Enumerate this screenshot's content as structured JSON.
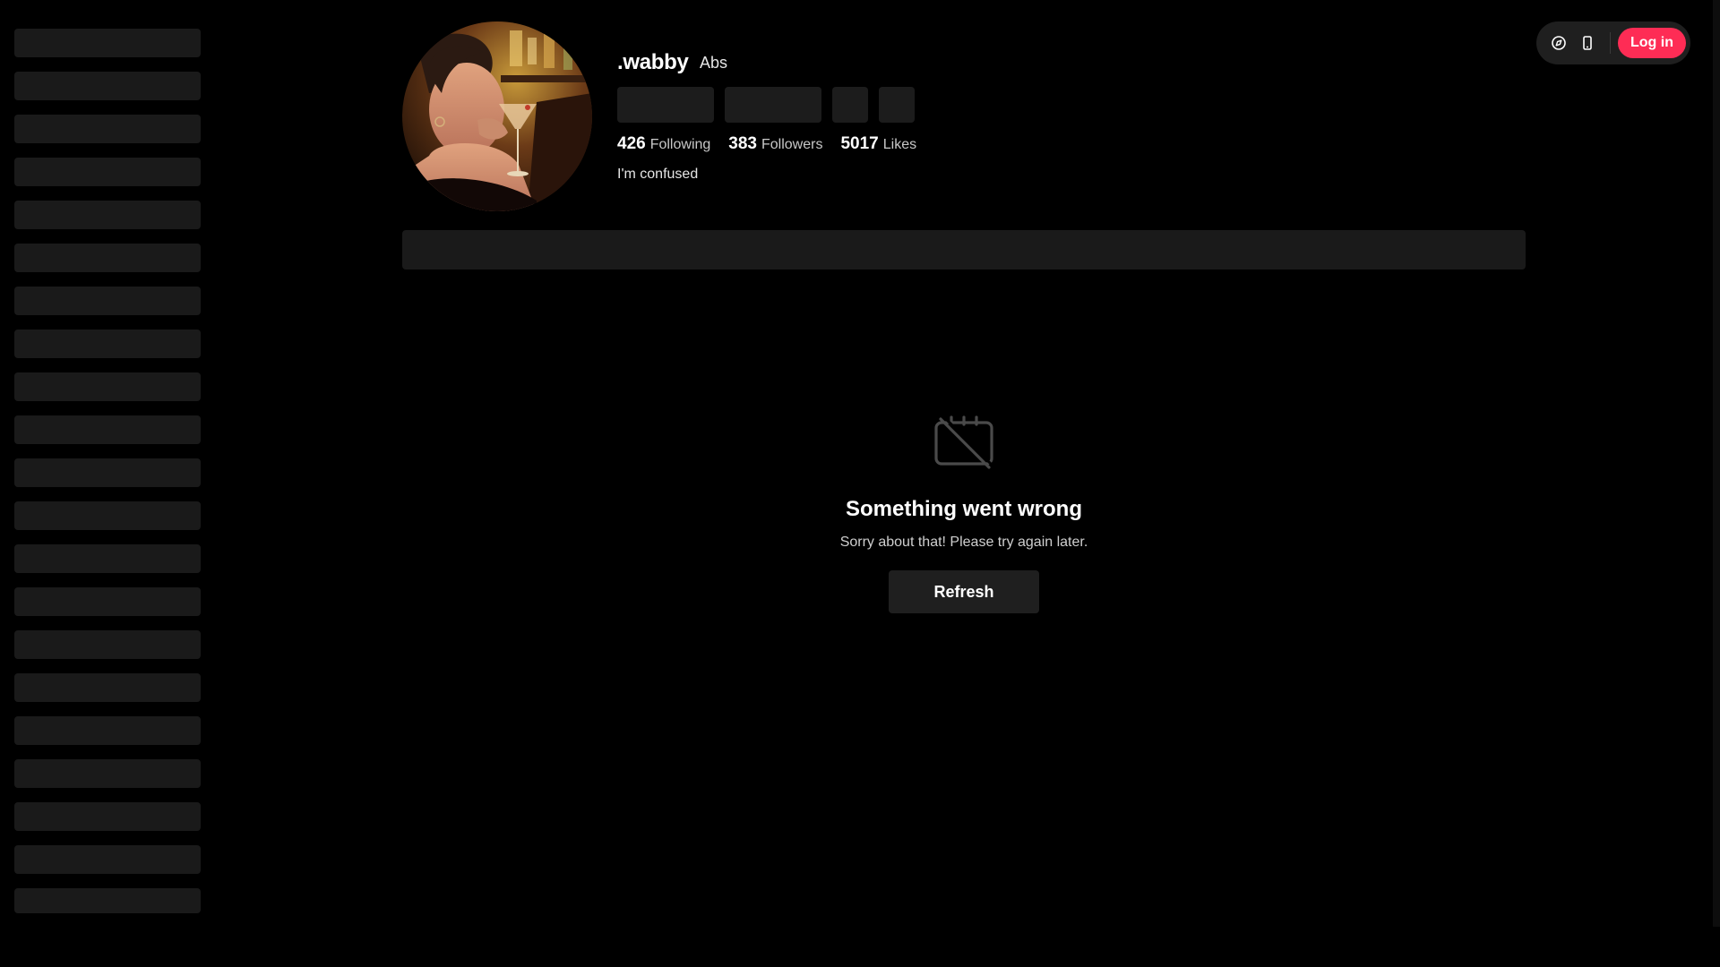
{
  "header": {
    "login_label": "Log in",
    "icons": [
      "compass-icon",
      "mobile-icon"
    ]
  },
  "sidebar": {
    "skeleton_rows": 21
  },
  "profile": {
    "username": ".wabby",
    "nickname": "Abs",
    "stats": [
      {
        "value": "426",
        "label": "Following"
      },
      {
        "value": "383",
        "label": "Followers"
      },
      {
        "value": "5017",
        "label": "Likes"
      }
    ],
    "bio": "I'm confused"
  },
  "error": {
    "title": "Something went wrong",
    "message": "Sorry about that! Please try again later.",
    "refresh_label": "Refresh"
  },
  "colors": {
    "background": "#000000",
    "accent": "#fe2c55",
    "skeleton": "#1a1a1a"
  }
}
